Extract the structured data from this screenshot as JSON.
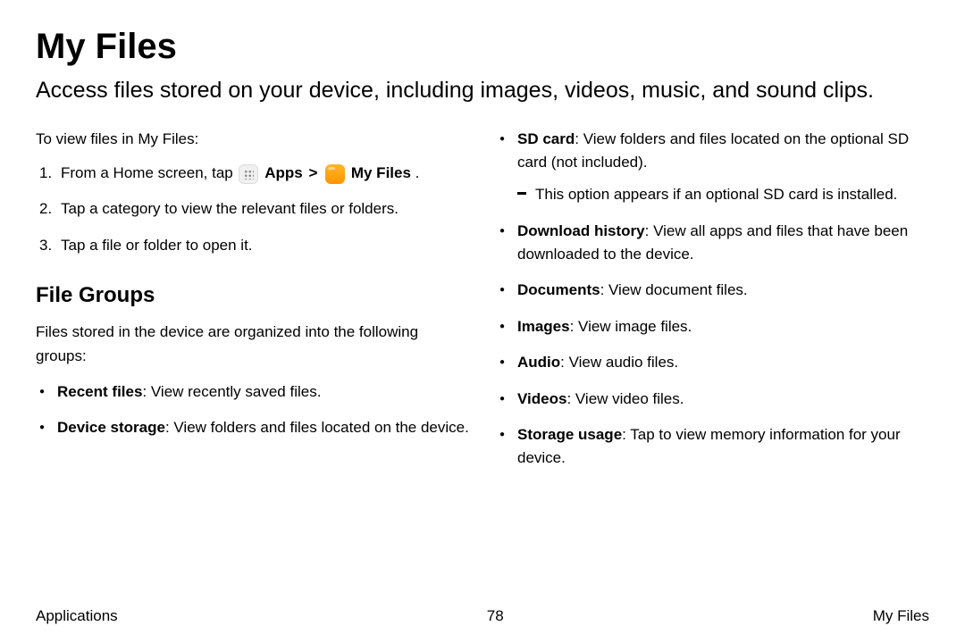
{
  "title": "My Files",
  "intro": "Access files stored on your device, including images, videos, music, and sound clips.",
  "leadIn": "To view files in My Files:",
  "steps": {
    "s1_pre": "From a Home screen, tap ",
    "s1_apps": "Apps",
    "s1_chevron": ">",
    "s1_myfiles": "My Files",
    "s1_period": " .",
    "s2": "Tap a category to view the relevant files or folders.",
    "s3": "Tap a file or folder to open it."
  },
  "subheading": "File Groups",
  "groupIntro": "Files stored in the device are organized into the following groups:",
  "left": {
    "i1_label": "Recent files",
    "i1_text": ": View recently saved files.",
    "i2_label": "Device storage",
    "i2_text": ": View folders and files located on the device."
  },
  "right": {
    "i1_label": "SD card",
    "i1_text": ": View folders and files located on the optional SD card (not included).",
    "i1_sub": "This option appears if an optional SD card is installed.",
    "i2_label": "Download history",
    "i2_text": ": View all apps and files that have been downloaded to the device.",
    "i3_label": "Documents",
    "i3_text": ": View document files.",
    "i4_label": "Images",
    "i4_text": ": View image files.",
    "i5_label": "Audio",
    "i5_text": ": View audio files.",
    "i6_label": "Videos",
    "i6_text": ": View video files.",
    "i7_label": "Storage usage",
    "i7_text": ": Tap to view memory information for your device."
  },
  "footer": {
    "left": "Applications",
    "center": "78",
    "right": "My Files"
  }
}
